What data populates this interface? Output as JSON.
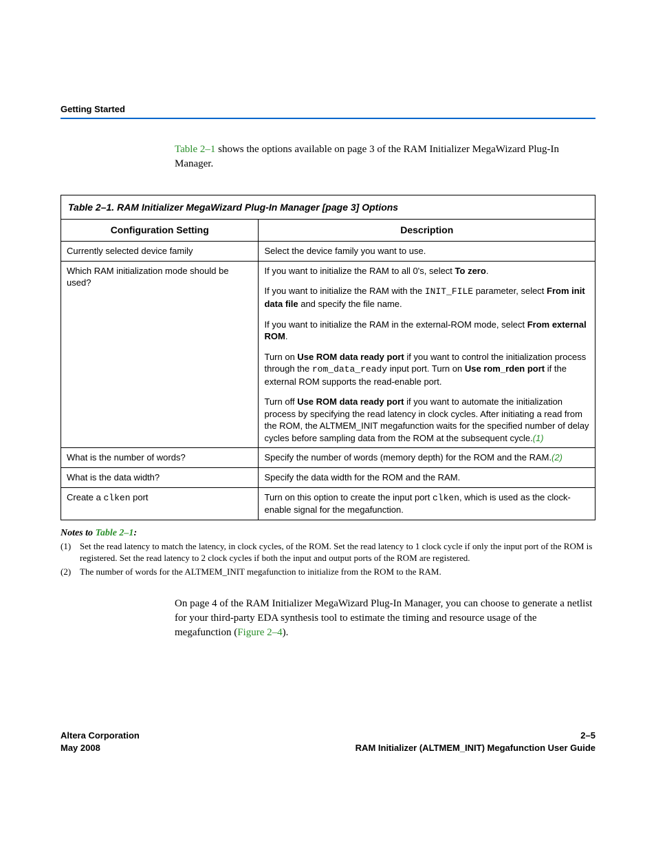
{
  "header": {
    "section": "Getting Started"
  },
  "intro": {
    "prefix_link": "Table 2–1",
    "rest": " shows the options available on page 3 of the RAM Initializer MegaWizard Plug-In Manager."
  },
  "table": {
    "title": "Table 2–1. RAM Initializer MegaWizard Plug-In Manager [page 3] Options",
    "col1": "Configuration Setting",
    "col2": "Description",
    "rows": {
      "r1": {
        "setting": "Currently selected device family",
        "desc": "Select the device family you want to use."
      },
      "r2": {
        "setting": "Which RAM initialization mode should be used?",
        "p1a": "If you want to initialize the RAM to all 0's, select ",
        "p1b": "To zero",
        "p1c": ".",
        "p2a": "If you want to initialize the RAM with the ",
        "p2code": "INIT_FILE",
        "p2b": " parameter, select ",
        "p2bold": "From init data file",
        "p2c": " and specify the file name.",
        "p3a": "If you want to initialize the RAM in the external-ROM mode, select ",
        "p3bold": "From external ROM",
        "p3b": ".",
        "p4a": "Turn on ",
        "p4bold1": "Use ROM data ready port",
        "p4b": " if you want to control the initialization process through the ",
        "p4code": "rom_data_ready",
        "p4c": " input port. Turn on ",
        "p4bold2": "Use rom_rden port",
        "p4d": " if the external ROM supports the read-enable port.",
        "p5a": "Turn off ",
        "p5bold": "Use ROM data ready port",
        "p5b": " if you want to automate the initialization process by specifying the read latency in clock cycles. After initiating a read from the ROM, the ALTMEM_INIT megafunction waits for the specified number of delay cycles before sampling data from the ROM at the subsequent cycle.",
        "p5ref": "(1)"
      },
      "r3": {
        "setting": "What is the number of words?",
        "desc": "Specify the number of words (memory depth) for the ROM and the RAM.",
        "ref": "(2)"
      },
      "r4": {
        "setting": "What is the data width?",
        "desc": "Specify the data width for the ROM and the RAM."
      },
      "r5": {
        "setting_a": "Create a ",
        "setting_code": "clken",
        "setting_b": " port",
        "desc_a": "Turn on this option to create the input port ",
        "desc_code": "clken",
        "desc_b": ", which is used as the clock-enable signal for the megafunction."
      }
    }
  },
  "notes": {
    "heading_a": "Notes to ",
    "heading_link": "Table 2–1",
    "heading_b": ":",
    "n1num": "(1)",
    "n1": "Set the read latency to match the latency, in clock cycles, of the ROM. Set the read latency to 1 clock cycle if only the input port of the ROM is registered. Set the read latency to 2 clock cycles if both the input and output ports of the ROM are registered.",
    "n2num": "(2)",
    "n2": "The number of words for the ALTMEM_INIT megafunction to initialize from the ROM to the RAM."
  },
  "body2": {
    "text_a": "On page 4 of the RAM Initializer MegaWizard Plug-In Manager, you can choose to generate a netlist for your third-party EDA synthesis tool to estimate the timing and resource usage of the megafunction (",
    "link": "Figure 2–4",
    "text_b": ")."
  },
  "footer": {
    "left1": "Altera Corporation",
    "left2": "May 2008",
    "right1": "2–5",
    "right2": "RAM Initializer (ALTMEM_INIT) Megafunction User Guide"
  }
}
